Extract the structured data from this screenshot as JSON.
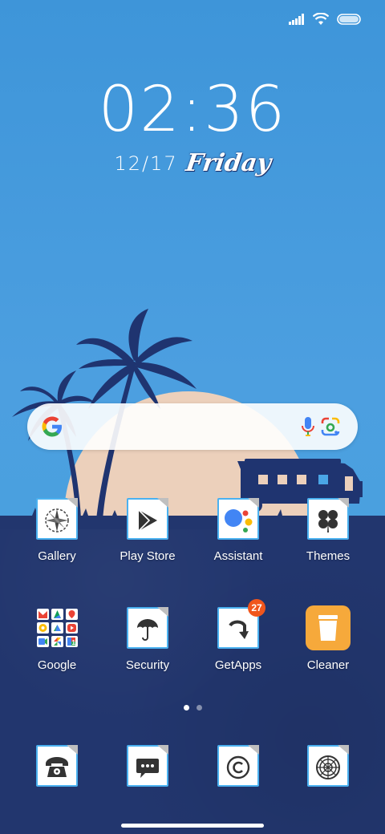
{
  "status_bar": {
    "signal_icon": "cellular-signal-icon",
    "wifi_icon": "wifi-icon",
    "battery_icon": "battery-icon"
  },
  "lock": {
    "time": "02:36",
    "date": "12/17",
    "weekday": "Friday"
  },
  "search_bar": {
    "google_icon": "google-g-icon",
    "mic_icon": "microphone-icon",
    "lens_icon": "google-lens-icon"
  },
  "apps": [
    {
      "label": "Gallery",
      "icon": "gallery-compass-icon"
    },
    {
      "label": "Play Store",
      "icon": "play-store-icon"
    },
    {
      "label": "Assistant",
      "icon": "assistant-icon"
    },
    {
      "label": "Themes",
      "icon": "clover-icon"
    },
    {
      "label": "Google",
      "icon": "google-folder-icon"
    },
    {
      "label": "Security",
      "icon": "umbrella-icon"
    },
    {
      "label": "GetApps",
      "icon": "getapps-arrow-icon",
      "badge": "27"
    },
    {
      "label": "Cleaner",
      "icon": "trash-bin-icon"
    }
  ],
  "dock": [
    {
      "icon": "phone-icon"
    },
    {
      "icon": "messages-icon"
    },
    {
      "icon": "copyright-icon"
    },
    {
      "icon": "camera-aperture-icon"
    }
  ],
  "pager": {
    "pages": 2,
    "current": 1
  },
  "colors": {
    "sky": "#4a9fe0",
    "ground": "#22366e",
    "sun": "#ecd0bb",
    "accent_blue": "#4ab1f0",
    "badge": "#f0561c",
    "cleaner": "#f6a93b"
  }
}
